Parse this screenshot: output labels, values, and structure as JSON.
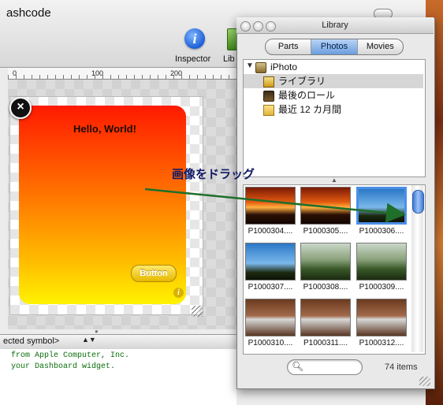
{
  "dashcode": {
    "title_fragment": "ashcode",
    "toolbar": {
      "inspector_label": "Inspector",
      "library_label_fragment": "Lib"
    },
    "ruler": {
      "ticks": [
        "0",
        "100",
        "200"
      ]
    },
    "widget": {
      "title": "Hello, World!",
      "button_label": "Button",
      "info_glyph": "i",
      "close_glyph": "×"
    },
    "symbol_popup": {
      "text": "ected symbol>",
      "arrows": "▲▼"
    },
    "console_lines": [
      "from Apple Computer, Inc.",
      "your Dashboard widget."
    ]
  },
  "library": {
    "title": "Library",
    "tabs": [
      {
        "label": "Parts",
        "active": false
      },
      {
        "label": "Photos",
        "active": true
      },
      {
        "label": "Movies",
        "active": false
      }
    ],
    "tree": {
      "root": "iPhoto",
      "items": [
        {
          "label": "ライブラリ",
          "selected": true,
          "icon": "photo-library-icon"
        },
        {
          "label": "最後のロール",
          "selected": false,
          "icon": "last-roll-icon"
        },
        {
          "label": "最近 12 カ月間",
          "selected": false,
          "icon": "calendar-icon"
        }
      ]
    },
    "photos": [
      {
        "label": "P1000304....",
        "style": "sunset",
        "selected": false
      },
      {
        "label": "P1000305....",
        "style": "sunset",
        "selected": false
      },
      {
        "label": "P1000306....",
        "style": "sky",
        "selected": true
      },
      {
        "label": "P1000307....",
        "style": "sky",
        "selected": false
      },
      {
        "label": "P1000308....",
        "style": "trees",
        "selected": false
      },
      {
        "label": "P1000309....",
        "style": "trees",
        "selected": false
      },
      {
        "label": "P1000310....",
        "style": "model",
        "selected": false
      },
      {
        "label": "P1000311....",
        "style": "model",
        "selected": false
      },
      {
        "label": "P1000312....",
        "style": "model",
        "selected": false
      }
    ],
    "search_placeholder": "",
    "item_count": "74 items"
  },
  "annotation": {
    "text": "画像をドラッグ",
    "arrow_color": "#1f6e2a"
  }
}
